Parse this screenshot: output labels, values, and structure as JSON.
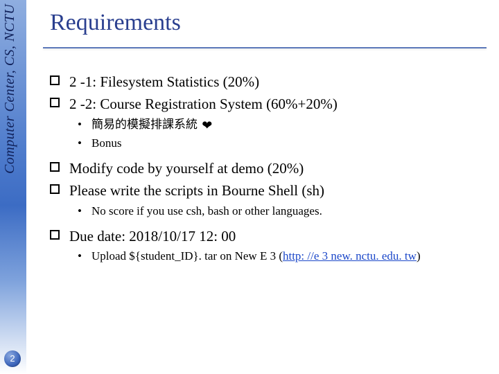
{
  "sidebar_text": "Computer Center, CS, NCTU",
  "title": "Requirements",
  "bullets": {
    "b0": "2 -1: Filesystem Statistics (20%)",
    "b1": "2 -2: Course Registration System (60%+20%)",
    "b1_sub": {
      "s0": "簡易的模擬排課系統",
      "s1": "Bonus"
    },
    "b2": "Modify code by yourself at demo (20%)",
    "b3": "Please write the scripts in Bourne Shell (sh)",
    "b3_sub": {
      "s0": "No score if you use csh, bash or other languages."
    },
    "b4": "Due date: 2018/10/17 12: 00",
    "b4_sub": {
      "prefix": "Upload ${student_ID}. tar on New E 3 (",
      "link": "http: //e 3 new. nctu. edu. tw",
      "suffix": ")"
    }
  },
  "heart_glyph": "❤",
  "page_number": "2"
}
